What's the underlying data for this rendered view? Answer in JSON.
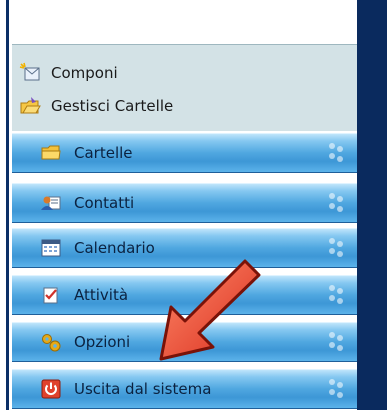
{
  "quick_actions": [
    {
      "label": "Componi",
      "icon": "compose-icon"
    },
    {
      "label": "Gestisci Cartelle",
      "icon": "manage-folders-icon"
    }
  ],
  "nav": [
    {
      "label": "Cartelle",
      "icon": "folder-icon"
    },
    {
      "label": "Contatti",
      "icon": "contacts-icon"
    },
    {
      "label": "Calendario",
      "icon": "calendar-icon"
    },
    {
      "label": "Attività",
      "icon": "tasks-icon"
    },
    {
      "label": "Opzioni",
      "icon": "options-gear-icon"
    },
    {
      "label": "Uscita dal sistema",
      "icon": "logout-power-icon"
    }
  ],
  "colors": {
    "nav_blue": "#4fa7e0",
    "dark_bar": "#0a2a5e",
    "panel_bg": "#d3e2e6",
    "arrow_red": "#e8452a"
  }
}
